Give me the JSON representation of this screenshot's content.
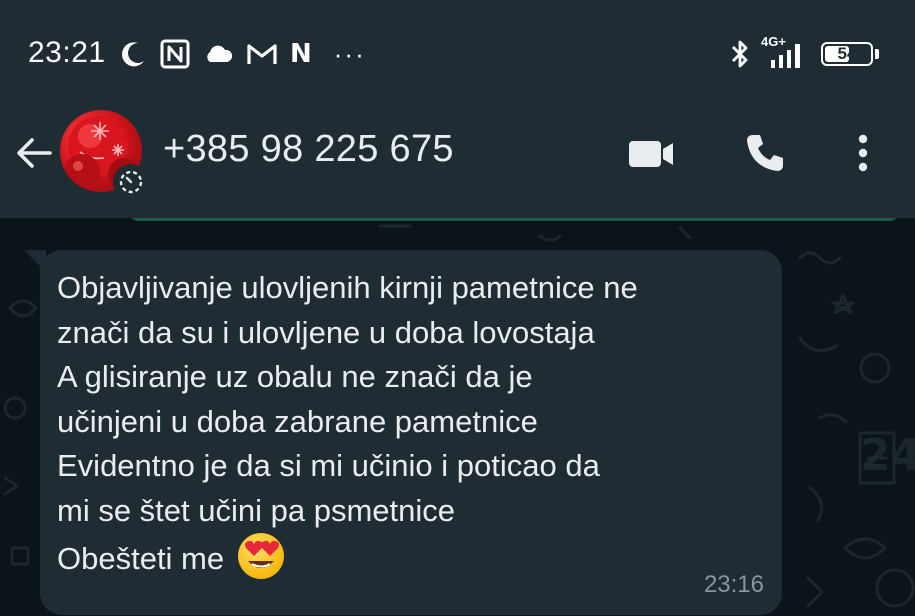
{
  "status_bar": {
    "time": "23:21",
    "left_icons": [
      "moon-icon",
      "nfc-icon",
      "cloud-icon",
      "gmail-icon",
      "n-app-icon",
      "more-notifications-icon"
    ],
    "n_glyph": "N",
    "more_dots": "···",
    "network_label": "4G+",
    "battery_level": "54",
    "battery_fraction": 0.54
  },
  "app_bar": {
    "contact_name": "+385 98 225 675",
    "icons": [
      "back-arrow-icon",
      "video-call-icon",
      "voice-call-icon",
      "overflow-menu-icon"
    ]
  },
  "message": {
    "lines": [
      "Objavljivanje ulovljenih kirnji pametnice ne",
      "znači da su i ulovljene u doba lovostaja",
      "A glisiranje uz obalu ne znači da je",
      "učinjeni u doba zabrane pametnice",
      "Evidentno je da si mi učinio i poticao da",
      "mi se štet učini pa psmetnice"
    ],
    "last_line": "Obešteti me",
    "emoji": "smiling-face-with-heart-eyes",
    "time": "23:16"
  },
  "colors": {
    "header_bg": "#1f2c34",
    "chat_bg": "#0b141a",
    "bubble_bg": "#202c33",
    "text": "#e9edef",
    "time_text": "#8696a0",
    "accent_strip": "#1a5c4c"
  }
}
